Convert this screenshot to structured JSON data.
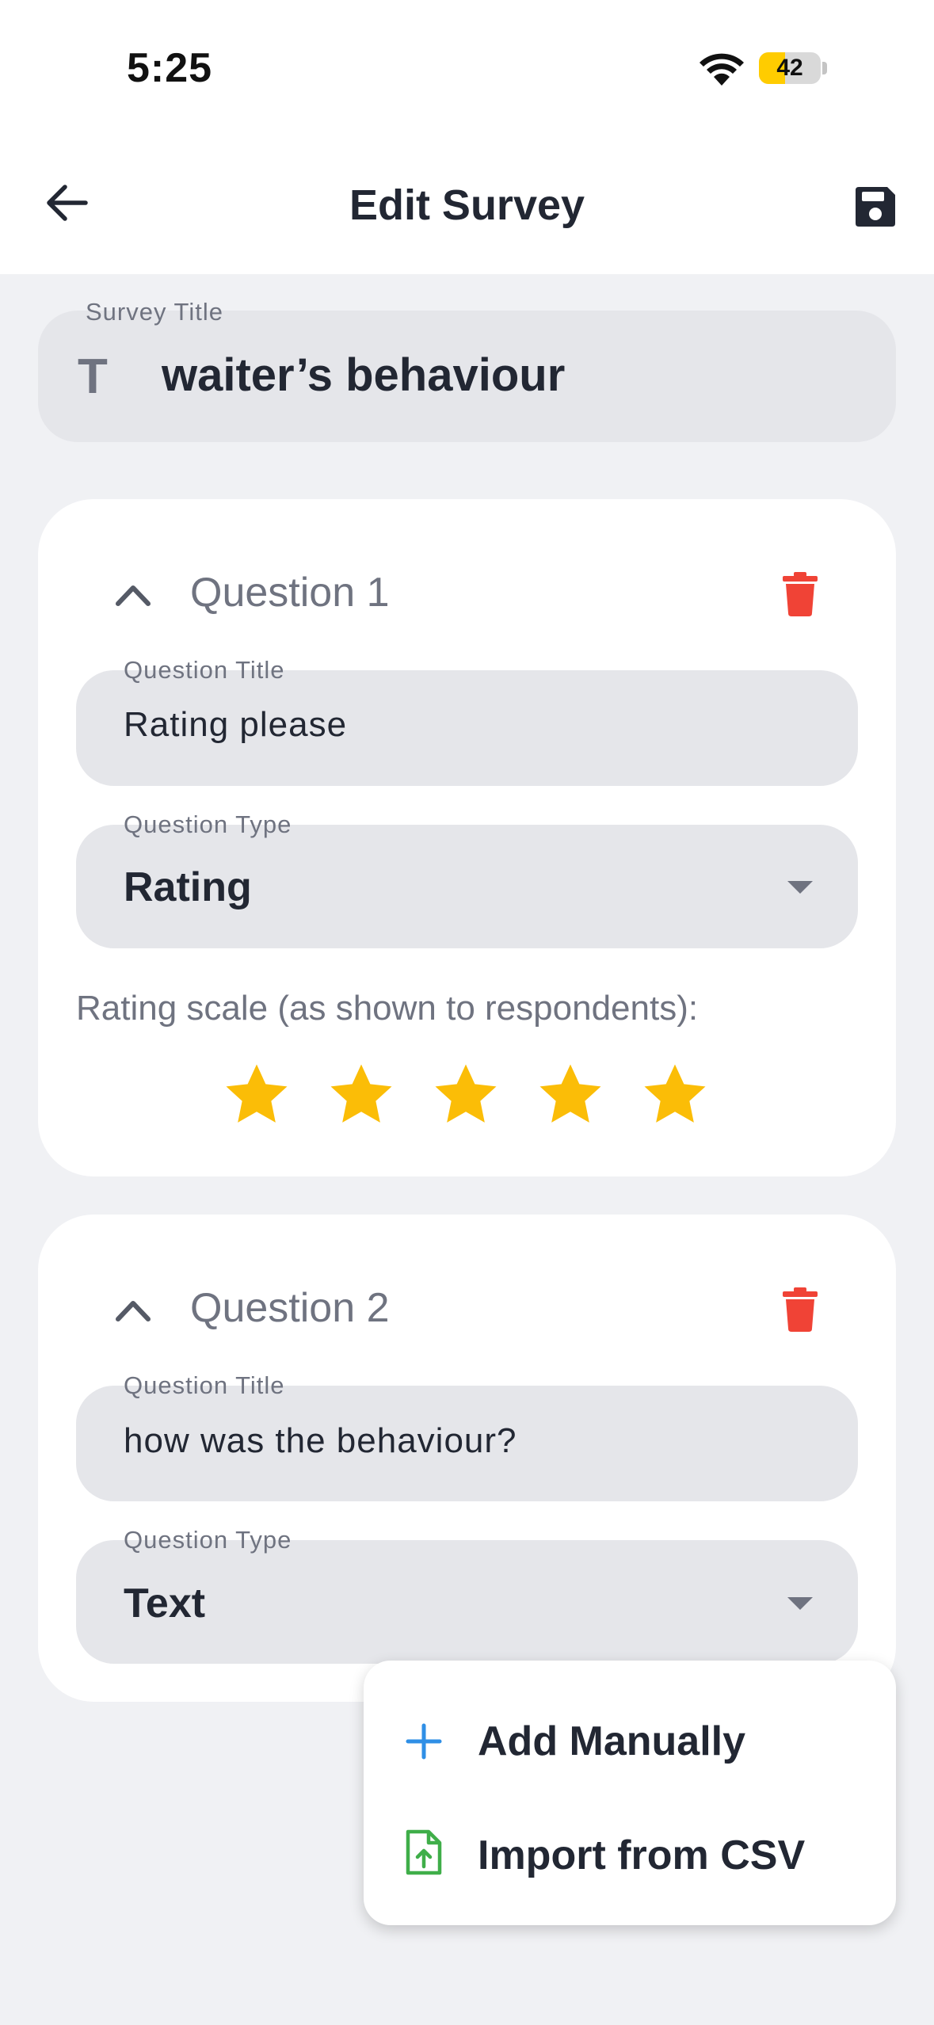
{
  "status_bar": {
    "time": "5:25",
    "battery_level": "42",
    "battery_fraction": 0.42,
    "battery_color": "#ffcc00"
  },
  "app_bar": {
    "title": "Edit Survey",
    "back_icon": "arrow-left-icon",
    "save_icon": "floppy-disk-icon"
  },
  "survey": {
    "title_label": "Survey Title",
    "title_icon": "T",
    "title_value": "waiter’s behaviour"
  },
  "questions": [
    {
      "heading": "Question 1",
      "title_label": "Question Title",
      "title_value": "Rating please",
      "type_label": "Question Type",
      "type_value": "Rating",
      "rating_label": "Rating scale (as shown to respondents):",
      "rating_stars": 5,
      "star_color": "#fbbd07"
    },
    {
      "heading": "Question 2",
      "title_label": "Question Title",
      "title_value": "how was the behaviour?",
      "type_label": "Question Type",
      "type_value": "Text"
    }
  ],
  "add_menu": {
    "items": [
      {
        "label": "Add Manually",
        "icon": "plus-icon",
        "icon_color": "#2f8fe6"
      },
      {
        "label": "Import from CSV",
        "icon": "file-upload-icon",
        "icon_color": "#3fae49"
      }
    ]
  },
  "colors": {
    "delete": "#f04336",
    "background": "#f0f1f4",
    "field": "#e5e6ea"
  }
}
